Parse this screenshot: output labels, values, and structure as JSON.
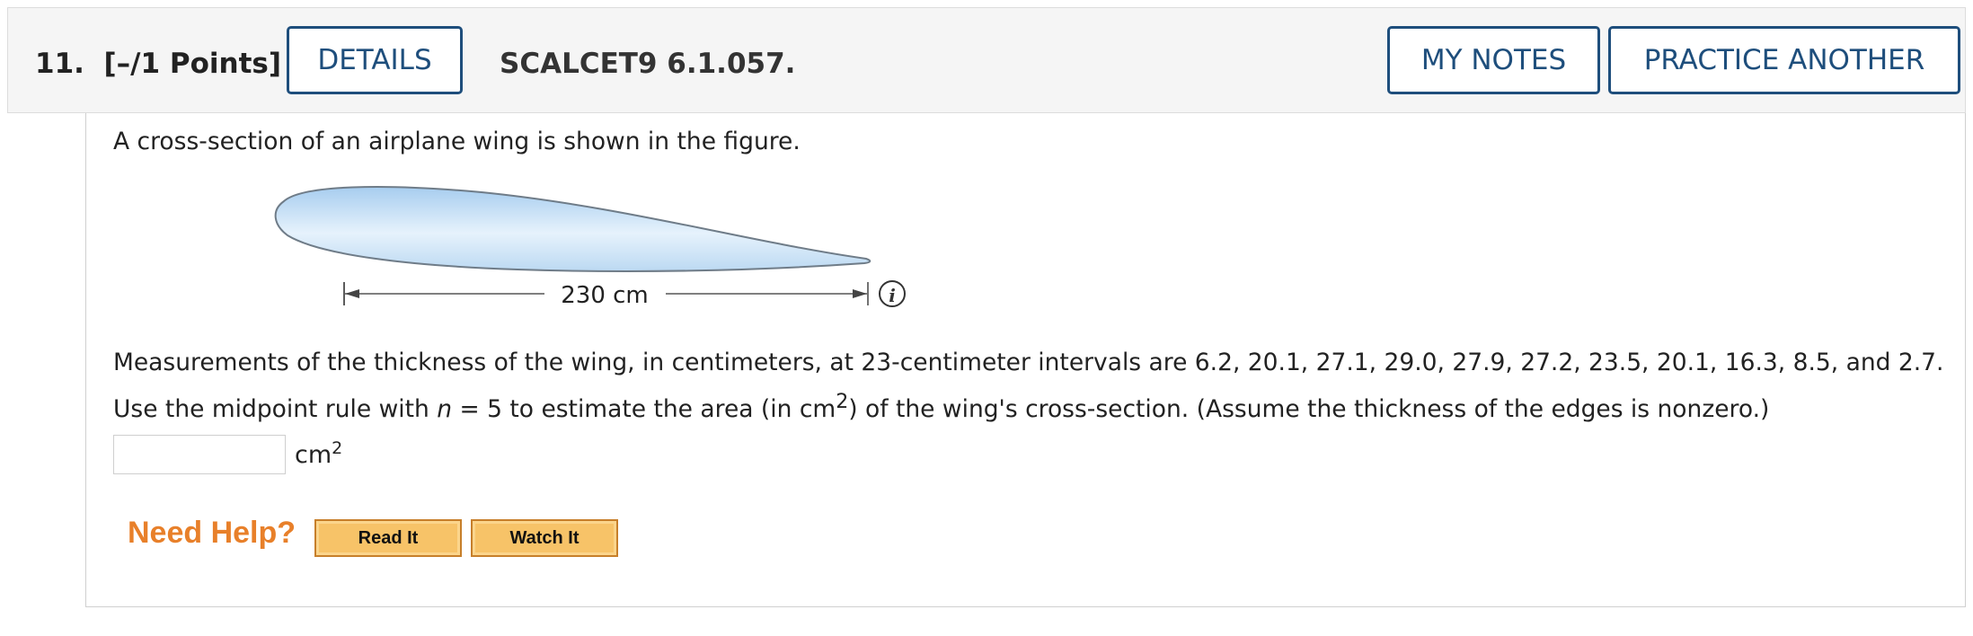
{
  "header": {
    "question_number": "11.",
    "points": "[–/1 Points]",
    "details_label": "DETAILS",
    "reference": "SCALCET9 6.1.057.",
    "my_notes_label": "MY NOTES",
    "practice_another_label": "PRACTICE ANOTHER"
  },
  "question": {
    "intro": "A cross-section of an airplane wing is shown in the figure.",
    "figure": {
      "dimension_label": "230 cm",
      "info_icon": "info-icon"
    },
    "text_part1": "Measurements of the thickness of the wing, in centimeters, at 23-centimeter intervals are 6.2, 20.1, 27.1, 29.0, 27.9, 27.2, 23.5, 20.1, 16.3, 8.5, and 2.7. Use the midpoint rule with ",
    "var_n": "n",
    "text_part2": " = 5 to estimate the area (in cm",
    "sup_2": "2",
    "text_part3": ") of the wing's cross-section. (Assume the thickness of the edges is nonzero.)",
    "answer": {
      "value": "",
      "unit": "cm",
      "unit_sup": "2"
    }
  },
  "help": {
    "label": "Need Help?",
    "read_it": "Read It",
    "watch_it": "Watch It"
  },
  "colors": {
    "accent": "#1e4e7c",
    "help_orange": "#e8802a",
    "help_button": "#f7c368"
  }
}
